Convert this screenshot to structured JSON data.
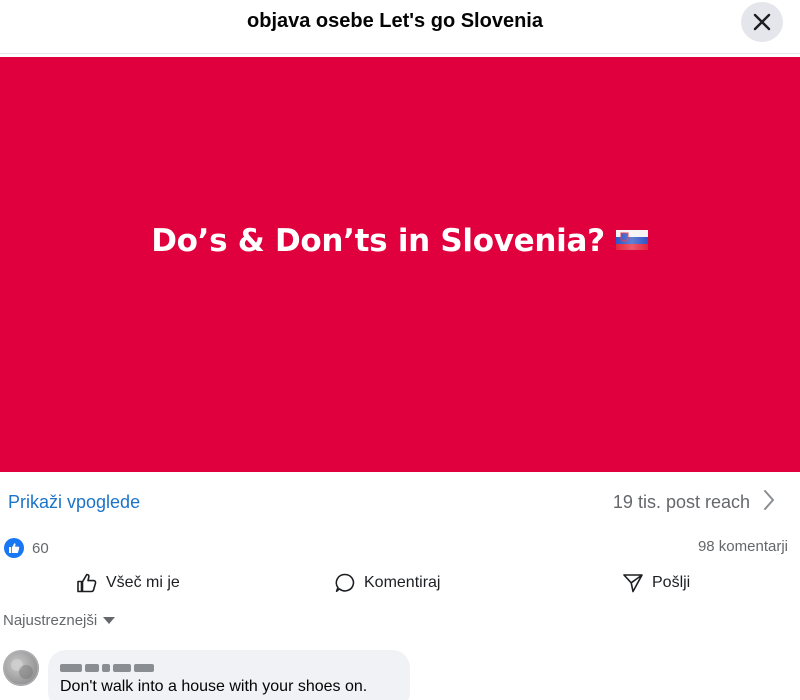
{
  "header": {
    "title": "objava osebe Let's go Slovenia",
    "close_icon": "close-icon"
  },
  "post": {
    "media_text": "Do’s & Don’ts in Slovenia?",
    "media_bg": "#df003d",
    "flag_icon": "slovenia-flag-icon"
  },
  "insights": {
    "link_label": "Prikaži vpoglede",
    "reach_label": "19 tis. post reach",
    "chevron_icon": "chevron-right-icon"
  },
  "stats": {
    "likes": "60",
    "comments": "98 komentarji"
  },
  "actions": {
    "like": "Všeč mi je",
    "comment": "Komentiraj",
    "share": "Pošlji"
  },
  "comments": {
    "sort_label": "Najustreznejši",
    "items": [
      {
        "text": "Don't walk into a house with your shoes on."
      }
    ]
  },
  "colors": {
    "link": "#1b74c8",
    "like_blue": "#1877f2",
    "muted": "#65676b"
  }
}
